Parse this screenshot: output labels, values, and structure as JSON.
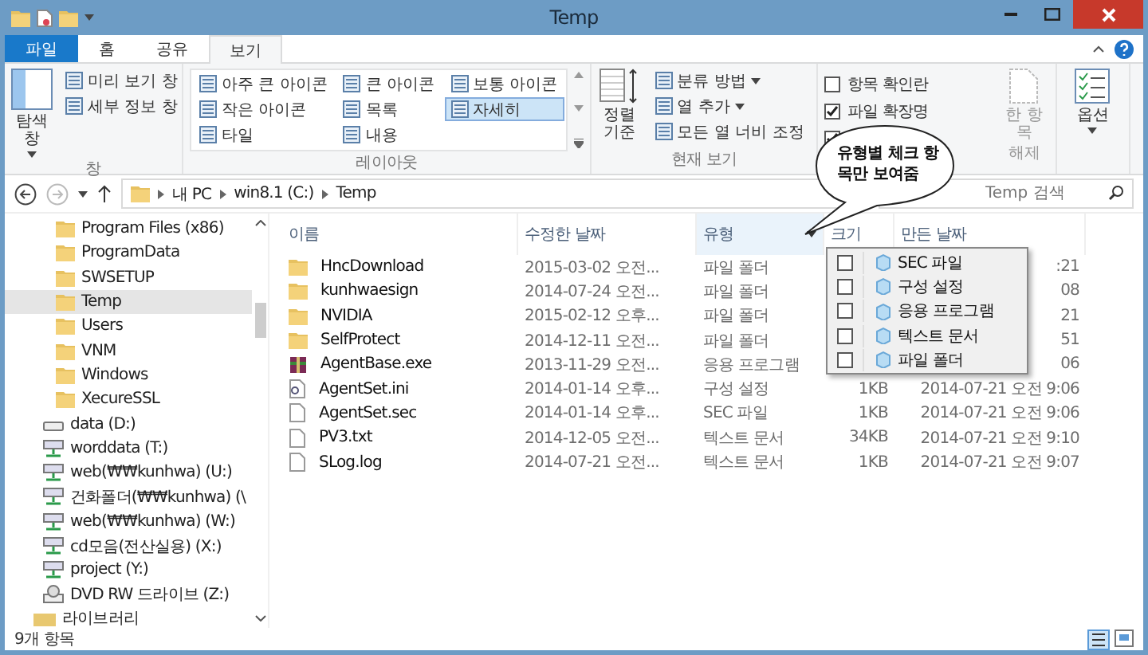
{
  "window": {
    "title": "Temp"
  },
  "ribbon_tabs": [
    {
      "label": "파일",
      "kind": "file",
      "selected": false
    },
    {
      "label": "홈",
      "kind": "tab",
      "selected": false
    },
    {
      "label": "공유",
      "kind": "tab",
      "selected": false
    },
    {
      "label": "보기",
      "kind": "tab",
      "selected": true
    }
  ],
  "ribbon": {
    "panes": {
      "label": "창",
      "big_button": "탐색 창",
      "items": [
        "미리 보기 창",
        "세부 정보 창"
      ]
    },
    "layout": {
      "label": "레이아웃",
      "items": [
        {
          "label": "아주 큰 아이콘",
          "selected": false
        },
        {
          "label": "작은 아이콘",
          "selected": false
        },
        {
          "label": "타일",
          "selected": false
        },
        {
          "label": "큰 아이콘",
          "selected": false
        },
        {
          "label": "목록",
          "selected": false
        },
        {
          "label": "내용",
          "selected": false
        },
        {
          "label": "보통 아이콘",
          "selected": false
        },
        {
          "label": "자세히",
          "selected": true
        }
      ]
    },
    "current_view": {
      "label": "현재 보기",
      "big_button": "정렬 기준",
      "items": [
        {
          "label": "분류 방법",
          "dropdown": true
        },
        {
          "label": "열 추가",
          "dropdown": true
        },
        {
          "label": "모든 열 너비 조정",
          "dropdown": false
        }
      ]
    },
    "show_hide": {
      "checks": [
        {
          "label": "항목 확인란",
          "checked": false
        },
        {
          "label": "파일 확장명",
          "checked": true
        },
        {
          "checked": true
        }
      ],
      "hide_button": [
        "한 항목",
        "해제"
      ]
    },
    "options": {
      "label": "옵션"
    }
  },
  "address": {
    "crumbs": [
      "내 PC",
      "win8.1 (C:)",
      "Temp"
    ],
    "search_placeholder": "Temp 검색"
  },
  "nav": [
    {
      "label": "Program Files (x86)",
      "kind": "folder",
      "selected": false
    },
    {
      "label": "ProgramData",
      "kind": "folder",
      "selected": false
    },
    {
      "label": "SWSETUP",
      "kind": "folder",
      "selected": false
    },
    {
      "label": "Temp",
      "kind": "folder",
      "selected": true
    },
    {
      "label": "Users",
      "kind": "folder",
      "selected": false
    },
    {
      "label": "VNM",
      "kind": "folder",
      "selected": false
    },
    {
      "label": "Windows",
      "kind": "folder",
      "selected": false
    },
    {
      "label": "XecureSSL",
      "kind": "folder",
      "selected": false
    },
    {
      "label": "data (D:)",
      "kind": "drive",
      "selected": false
    },
    {
      "label": "worddata (T:)",
      "kind": "network",
      "selected": false
    },
    {
      "label": "web(₩₩kunhwa) (U:)",
      "kind": "network",
      "selected": false
    },
    {
      "label": "건화폴더(₩₩kunhwa) (\\",
      "kind": "network",
      "selected": false
    },
    {
      "label": "web(₩₩kunhwa) (W:)",
      "kind": "network",
      "selected": false
    },
    {
      "label": "cd모음(전산실용) (X:)",
      "kind": "network",
      "selected": false
    },
    {
      "label": "project (Y:)",
      "kind": "network",
      "selected": false
    },
    {
      "label": "DVD RW 드라이브 (Z:)",
      "kind": "dvd",
      "selected": false
    },
    {
      "label": "라이브러리",
      "kind": "library",
      "selected": false
    }
  ],
  "columns": [
    {
      "label": "이름",
      "filter_open": false
    },
    {
      "label": "수정한 날짜",
      "filter_open": false
    },
    {
      "label": "유형",
      "filter_open": true
    },
    {
      "label": "크기",
      "filter_open": false
    },
    {
      "label": "만든 날짜",
      "filter_open": false
    }
  ],
  "rows": [
    {
      "name": "HncDownload",
      "kind": "folder",
      "modified": "2015-03-02 오전...",
      "type": "파일 폴더",
      "created": ":21"
    },
    {
      "name": "kunhwaesign",
      "kind": "folder",
      "modified": "2014-07-24 오전...",
      "type": "파일 폴더",
      "created": "08"
    },
    {
      "name": "NVIDIA",
      "kind": "folder",
      "modified": "2015-02-12 오후...",
      "type": "파일 폴더",
      "created": "21"
    },
    {
      "name": "SelfProtect",
      "kind": "folder",
      "modified": "2014-12-11 오전...",
      "type": "파일 폴더",
      "created": "51"
    },
    {
      "name": "AgentBase.exe",
      "kind": "exe",
      "modified": "2013-11-29 오전...",
      "type": "응용 프로그램",
      "created": "06"
    },
    {
      "name": "AgentSet.ini",
      "kind": "ini",
      "modified": "2014-01-14 오후...",
      "type": "구성 설정",
      "size": "1KB",
      "created": "2014-07-21 오전 9:06"
    },
    {
      "name": "AgentSet.sec",
      "kind": "file",
      "modified": "2014-01-14 오후...",
      "type": "SEC 파일",
      "size": "1KB",
      "created": "2014-07-21 오전 9:06"
    },
    {
      "name": "PV3.txt",
      "kind": "file",
      "modified": "2014-12-05 오전...",
      "type": "텍스트 문서",
      "size": "34KB",
      "created": "2014-07-21 오전 9:10"
    },
    {
      "name": "SLog.log",
      "kind": "file",
      "modified": "2014-07-21 오전...",
      "type": "텍스트 문서",
      "size": "1KB",
      "created": "2014-07-21 오전 9:07"
    }
  ],
  "filter_menu": [
    {
      "label": "SEC 파일",
      "checked": false
    },
    {
      "label": "구성 설정",
      "checked": false
    },
    {
      "label": "응용 프로그램",
      "checked": false
    },
    {
      "label": "텍스트 문서",
      "checked": false
    },
    {
      "label": "파일 폴더",
      "checked": false
    }
  ],
  "callout": {
    "text": "유형별 체크 항목만 보여줌"
  },
  "status_bar": {
    "count": "9개 항목"
  }
}
